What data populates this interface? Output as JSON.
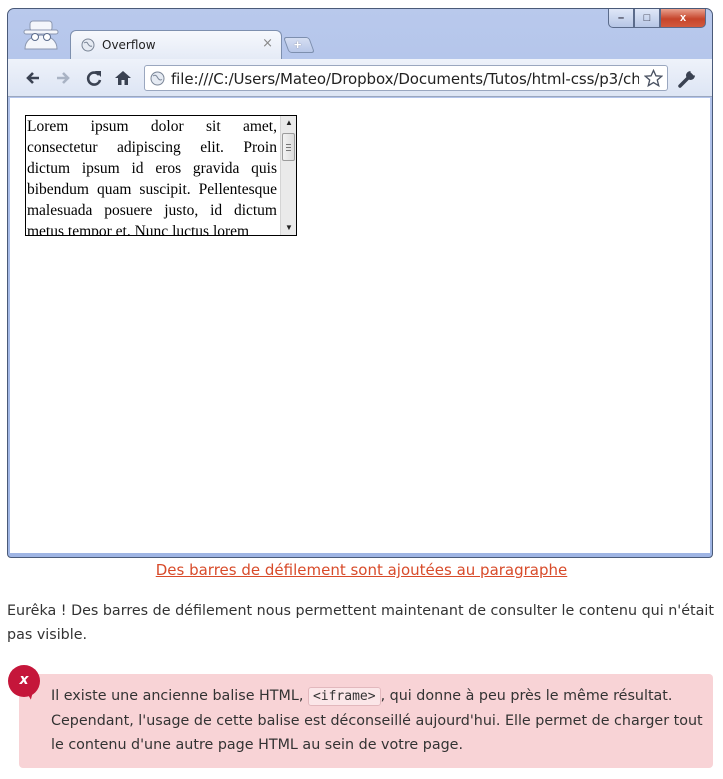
{
  "browser": {
    "tab_title": "Overflow",
    "tab_close": "×",
    "new_tab": "+",
    "window_controls": {
      "minimize": "–",
      "maximize": "□",
      "close": "x"
    },
    "toolbar": {
      "back_icon": "arrow-left-icon",
      "forward_icon": "arrow-right-icon",
      "reload_icon": "reload-icon",
      "home_icon": "home-icon",
      "url": "file:///C:/Users/Mateo/Dropbox/Documents/Tutos/html-css/p3/ch",
      "bookmark_icon": "star-icon",
      "menu_icon": "wrench-icon"
    },
    "page": {
      "scroll_paragraph": "Lorem ipsum dolor sit amet, consectetur adipiscing elit. Proin dictum ipsum id eros gravida quis bibendum quam suscipit. Pellentesque malesuada posuere justo, id dictum metus tempor et. Nunc luctus lorem"
    }
  },
  "caption": "Des barres de défilement sont ajoutées au paragraphe",
  "body_text": "Eurêka ! Des barres de défilement nous permettent maintenant de consulter le contenu qui n'était pas visible.",
  "alert": {
    "badge": "x",
    "text_before": "Il existe une ancienne balise HTML, ",
    "code": "<iframe>",
    "text_after": ", qui donne à peu près le même résultat. Cependant, l'usage de cette balise est déconseillé aujourd'hui. Elle permet de charger tout le contenu d'une autre page HTML au sein de votre page."
  },
  "colors": {
    "caption_link": "#d84b2a",
    "alert_background": "#f8d3d6",
    "alert_badge": "#c5163a"
  }
}
